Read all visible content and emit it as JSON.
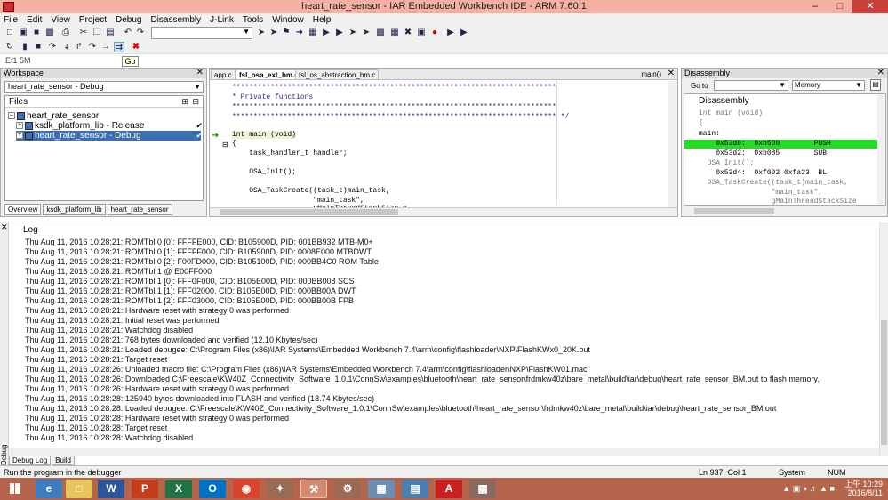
{
  "window": {
    "title": "heart_rate_sensor - IAR Embedded Workbench IDE - ARM 7.60.1",
    "minimize": "–",
    "maximize": "□",
    "close": "✕"
  },
  "menu": [
    "File",
    "Edit",
    "View",
    "Project",
    "Debug",
    "Disassembly",
    "J-Link",
    "Tools",
    "Window",
    "Help"
  ],
  "toolbar": {
    "go_tooltip": "Go",
    "small_label": "Ef1 5M"
  },
  "workspace": {
    "title": "Workspace",
    "close": "✕",
    "config": "heart_rate_sensor - Debug",
    "files_header": "Files",
    "tree": [
      {
        "label": "heart_rate_sensor",
        "check": ""
      },
      {
        "label": "ksdk_platform_lib - Release",
        "check": "✔"
      },
      {
        "label": "heart_rate_sensor - Debug",
        "check": "✔"
      }
    ],
    "tabs": [
      "Overview",
      "ksdk_platform_lib",
      "heart_rate_sensor"
    ]
  },
  "editor": {
    "tabs": [
      "app.c",
      "fsl_osa_ext_bm.c",
      "fsl_os_abstraction_bm.c"
    ],
    "function": "main()",
    "close": "✕",
    "lines": [
      "****************************************************************************",
      "* Private functions",
      "****************************************************************************",
      "**************************************************************************** */",
      "",
      "int main (void)",
      "{",
      "    task_handler_t handler;",
      "",
      "    OSA_Init();",
      "",
      "    OSA_TaskCreate((task_t)main_task,",
      "                   \"main_task\",",
      "                   gMainThreadStackSize_c,"
    ]
  },
  "disassembly": {
    "title": "Disassembly",
    "close": "✕",
    "goto_label": "Go to",
    "memory": "Memory",
    "panel_title": "Disassembly",
    "lines": [
      {
        "text": "int main (void)",
        "src": true
      },
      {
        "text": "{",
        "src": true
      },
      {
        "text": "main:",
        "src": false
      },
      {
        "text": "    0x53d0:  0xb500        PUSH",
        "src": false
      },
      {
        "text": "    0x53d2:  0xb085        SUB",
        "src": false
      },
      {
        "text": "  OSA_Init();",
        "src": true
      },
      {
        "text": "    0x53d4:  0xf002 0xfa23  BL",
        "src": false
      },
      {
        "text": "  OSA_TaskCreate((task_t)main_task,",
        "src": true
      },
      {
        "text": "                 \"main_task\",",
        "src": true
      },
      {
        "text": "                 gMainThreadStackSize",
        "src": true
      }
    ]
  },
  "log": {
    "header": "Log",
    "side_label": "Debug Log",
    "tabs": [
      "Debug Log",
      "Build"
    ],
    "lines": [
      "Thu Aug 11, 2016 10:28:21: ROMTbl 0 [0]: FFFFE000, CID: B105900D, PID: 001BB932 MTB-M0+",
      "Thu Aug 11, 2016 10:28:21: ROMTbl 0 [1]: FFFFF000, CID: B105900D, PID: 0008E000 MTBDWT",
      "Thu Aug 11, 2016 10:28:21: ROMTbl 0 [2]: F00FD000, CID: B105100D, PID: 000BB4C0 ROM Table",
      "Thu Aug 11, 2016 10:28:21: ROMTbl 1 @ E00FF000",
      "Thu Aug 11, 2016 10:28:21: ROMTbl 1 [0]: FFF0F000, CID: B105E00D, PID: 000BB008 SCS",
      "Thu Aug 11, 2016 10:28:21: ROMTbl 1 [1]: FFF02000, CID: B105E00D, PID: 000BB00A DWT",
      "Thu Aug 11, 2016 10:28:21: ROMTbl 1 [2]: FFF03000, CID: B105E00D, PID: 000BB00B FPB",
      "Thu Aug 11, 2016 10:28:21: Hardware reset with strategy 0 was performed",
      "Thu Aug 11, 2016 10:28:21: Initial reset was performed",
      "Thu Aug 11, 2016 10:28:21: Watchdog disabled",
      "Thu Aug 11, 2016 10:28:21: 768 bytes downloaded and verified (12.10 Kbytes/sec)",
      "Thu Aug 11, 2016 10:28:21: Loaded debugee: C:\\Program Files (x86)\\IAR Systems\\Embedded Workbench 7.4\\arm\\config\\flashloader\\NXP\\FlashKWx0_20K.out",
      "Thu Aug 11, 2016 10:28:21: Target reset",
      "Thu Aug 11, 2016 10:28:26: Unloaded macro file: C:\\Program Files (x86)\\IAR Systems\\Embedded Workbench 7.4\\arm\\config\\flashloader\\NXP\\FlashKW01.mac",
      "Thu Aug 11, 2016 10:28:26: Downloaded C:\\Freescale\\KW40Z_Connectivity_Software_1.0.1\\ConnSw\\examples\\bluetooth\\heart_rate_sensor\\frdmkw40z\\bare_metal\\build\\iar\\debug\\heart_rate_sensor_BM.out to flash memory.",
      "Thu Aug 11, 2016 10:28:26: Hardware reset with strategy 0 was performed",
      "Thu Aug 11, 2016 10:28:28: 125940 bytes downloaded into FLASH and verified (18.74 Kbytes/sec)",
      "Thu Aug 11, 2016 10:28:28: Loaded debugee: C:\\Freescale\\KW40Z_Connectivity_Software_1.0.1\\ConnSw\\examples\\bluetooth\\heart_rate_sensor\\frdmkw40z\\bare_metal\\build\\iar\\debug\\heart_rate_sensor_BM.out",
      "Thu Aug 11, 2016 10:28:28: Hardware reset with strategy 0 was performed",
      "Thu Aug 11, 2016 10:28:28: Target reset",
      "Thu Aug 11, 2016 10:28:28: Watchdog disabled"
    ]
  },
  "status": {
    "message": "Run the program in the debugger",
    "position": "Ln 937, Col 1",
    "encoding": "System",
    "num": "NUM"
  },
  "taskbar": {
    "time": "上午 10:29",
    "date": "2016/8/11"
  }
}
